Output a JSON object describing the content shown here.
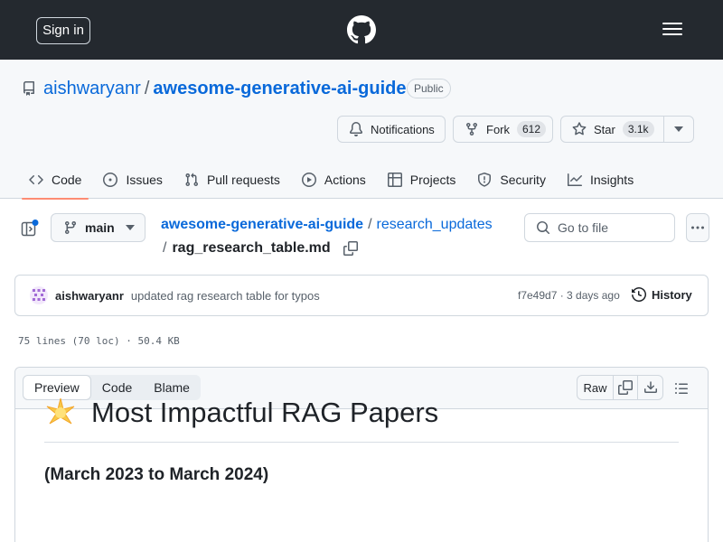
{
  "header": {
    "signin_label": "Sign in"
  },
  "repo": {
    "owner": "aishwaryanr",
    "separator": "/",
    "name": "awesome-generative-ai-guide",
    "visibility": "Public",
    "notifications_label": "Notifications",
    "fork_label": "Fork",
    "fork_count": "612",
    "star_label": "Star",
    "star_count": "3.1k"
  },
  "tabs": [
    {
      "label": "Code",
      "icon": "code-icon",
      "active": true
    },
    {
      "label": "Issues",
      "icon": "issue-opened-icon"
    },
    {
      "label": "Pull requests",
      "icon": "git-pull-request-icon"
    },
    {
      "label": "Actions",
      "icon": "play-icon"
    },
    {
      "label": "Projects",
      "icon": "table-icon"
    },
    {
      "label": "Security",
      "icon": "shield-icon"
    },
    {
      "label": "Insights",
      "icon": "graph-icon"
    }
  ],
  "file_nav": {
    "branch": "main",
    "path_repo": "awesome-generative-ai-guide",
    "path_sep": "/",
    "path_dir": "research_updates",
    "file_name": "rag_research_table.md",
    "goto_placeholder": "Go to file"
  },
  "commit": {
    "author": "aishwaryanr",
    "message": "updated rag research table for typos",
    "meta": "f7e49d7 · 3 days ago",
    "history_label": "History"
  },
  "file_info": "75 lines (70 loc) · 50.4 KB",
  "viewer": {
    "modes": [
      "Preview",
      "Code",
      "Blame"
    ],
    "active_mode": "Preview",
    "raw_label": "Raw"
  },
  "content": {
    "h1": "Most Impactful RAG Papers",
    "h3": "(March 2023 to March 2024)"
  },
  "colors": {
    "header_bg": "#24292f",
    "link": "#0969da",
    "tab_underline": "#fd8c73",
    "notification_dot": "#0969da"
  }
}
